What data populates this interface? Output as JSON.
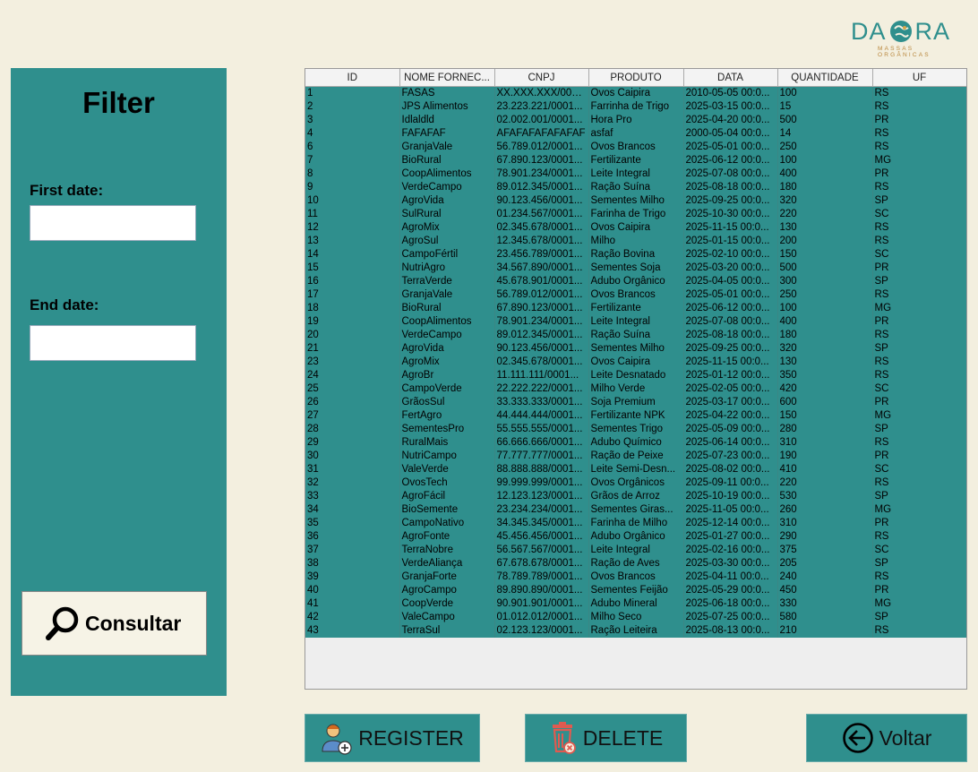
{
  "brand": {
    "logo_text_left": "DA",
    "logo_text_right": "RA",
    "logo_subtitle": "MASSAS ORGÂNICAS",
    "accent": "#2f8f8d"
  },
  "filter": {
    "title": "Filter",
    "first_date_label": "First date:",
    "first_date_value": "",
    "end_date_label": "End date:",
    "end_date_value": "",
    "consultar_label": "Consultar"
  },
  "table": {
    "columns": [
      "ID",
      "NOME FORNEC...",
      "CNPJ",
      "PRODUTO",
      "DATA",
      "QUANTIDADE",
      "UF"
    ],
    "rows": [
      [
        "1",
        "FASAS",
        "XX.XXX.XXX/0001...",
        "Ovos Caipira",
        "2010-05-05 00:0...",
        "100",
        "RS"
      ],
      [
        "2",
        "JPS Alimentos",
        "23.223.221/0001...",
        "Farrinha de Trigo",
        "2025-03-15 00:0...",
        "15",
        "RS"
      ],
      [
        "3",
        "Idlaldld",
        "02.002.001/0001...",
        "Hora Pro",
        "2025-04-20 00:0...",
        "500",
        "PR"
      ],
      [
        "4",
        "FAFAFAF",
        "AFAFAFAFAFAFAF",
        "asfaf",
        "2000-05-04 00:0...",
        "14",
        "RS"
      ],
      [
        "6",
        "GranjaVale",
        "56.789.012/0001...",
        "Ovos Brancos",
        "2025-05-01 00:0...",
        "250",
        "RS"
      ],
      [
        "7",
        "BioRural",
        "67.890.123/0001...",
        "Fertilizante",
        "2025-06-12 00:0...",
        "100",
        "MG"
      ],
      [
        "8",
        "CoopAlimentos",
        "78.901.234/0001...",
        "Leite Integral",
        "2025-07-08 00:0...",
        "400",
        "PR"
      ],
      [
        "9",
        "VerdeCampo",
        "89.012.345/0001...",
        "Ração Suína",
        "2025-08-18 00:0...",
        "180",
        "RS"
      ],
      [
        "10",
        "AgroVida",
        "90.123.456/0001...",
        "Sementes Milho",
        "2025-09-25 00:0...",
        "320",
        "SP"
      ],
      [
        "11",
        "SulRural",
        "01.234.567/0001...",
        "Farinha de Trigo",
        "2025-10-30 00:0...",
        "220",
        "SC"
      ],
      [
        "12",
        "AgroMix",
        "02.345.678/0001...",
        "Ovos Caipira",
        "2025-11-15 00:0...",
        "130",
        "RS"
      ],
      [
        "13",
        "AgroSul",
        "12.345.678/0001...",
        "Milho",
        "2025-01-15 00:0...",
        "200",
        "RS"
      ],
      [
        "14",
        "CampoFértil",
        "23.456.789/0001...",
        "Ração Bovina",
        "2025-02-10 00:0...",
        "150",
        "SC"
      ],
      [
        "15",
        "NutriAgro",
        "34.567.890/0001...",
        "Sementes Soja",
        "2025-03-20 00:0...",
        "500",
        "PR"
      ],
      [
        "16",
        "TerraVerde",
        "45.678.901/0001...",
        "Adubo Orgânico",
        "2025-04-05 00:0...",
        "300",
        "SP"
      ],
      [
        "17",
        "GranjaVale",
        "56.789.012/0001...",
        "Ovos Brancos",
        "2025-05-01 00:0...",
        "250",
        "RS"
      ],
      [
        "18",
        "BioRural",
        "67.890.123/0001...",
        "Fertilizante",
        "2025-06-12 00:0...",
        "100",
        "MG"
      ],
      [
        "19",
        "CoopAlimentos",
        "78.901.234/0001...",
        "Leite Integral",
        "2025-07-08 00:0...",
        "400",
        "PR"
      ],
      [
        "20",
        "VerdeCampo",
        "89.012.345/0001...",
        "Ração Suína",
        "2025-08-18 00:0...",
        "180",
        "RS"
      ],
      [
        "21",
        "AgroVida",
        "90.123.456/0001...",
        "Sementes Milho",
        "2025-09-25 00:0...",
        "320",
        "SP"
      ],
      [
        "23",
        "AgroMix",
        "02.345.678/0001...",
        "Ovos Caipira",
        "2025-11-15 00:0...",
        "130",
        "RS"
      ],
      [
        "24",
        "AgroBr",
        "11.111.111/0001...",
        "Leite Desnatado",
        "2025-01-12 00:0...",
        "350",
        "RS"
      ],
      [
        "25",
        "CampoVerde",
        "22.222.222/0001...",
        "Milho Verde",
        "2025-02-05 00:0...",
        "420",
        "SC"
      ],
      [
        "26",
        "GrãosSul",
        "33.333.333/0001...",
        "Soja Premium",
        "2025-03-17 00:0...",
        "600",
        "PR"
      ],
      [
        "27",
        "FertAgro",
        "44.444.444/0001...",
        "Fertilizante NPK",
        "2025-04-22 00:0...",
        "150",
        "MG"
      ],
      [
        "28",
        "SementesPro",
        "55.555.555/0001...",
        "Sementes Trigo",
        "2025-05-09 00:0...",
        "280",
        "SP"
      ],
      [
        "29",
        "RuralMais",
        "66.666.666/0001...",
        "Adubo Químico",
        "2025-06-14 00:0...",
        "310",
        "RS"
      ],
      [
        "30",
        "NutriCampo",
        "77.777.777/0001...",
        "Ração de Peixe",
        "2025-07-23 00:0...",
        "190",
        "PR"
      ],
      [
        "31",
        "ValeVerde",
        "88.888.888/0001...",
        "Leite Semi-Desn...",
        "2025-08-02 00:0...",
        "410",
        "SC"
      ],
      [
        "32",
        "OvosTech",
        "99.999.999/0001...",
        "Ovos Orgânicos",
        "2025-09-11 00:0...",
        "220",
        "RS"
      ],
      [
        "33",
        "AgroFácil",
        "12.123.123/0001...",
        "Grãos de Arroz",
        "2025-10-19 00:0...",
        "530",
        "SP"
      ],
      [
        "34",
        "BioSemente",
        "23.234.234/0001...",
        "Sementes Giras...",
        "2025-11-05 00:0...",
        "260",
        "MG"
      ],
      [
        "35",
        "CampoNativo",
        "34.345.345/0001...",
        "Farinha de Milho",
        "2025-12-14 00:0...",
        "310",
        "PR"
      ],
      [
        "36",
        "AgroFonte",
        "45.456.456/0001...",
        "Adubo Orgânico",
        "2025-01-27 00:0...",
        "290",
        "RS"
      ],
      [
        "37",
        "TerraNobre",
        "56.567.567/0001...",
        "Leite Integral",
        "2025-02-16 00:0...",
        "375",
        "SC"
      ],
      [
        "38",
        "VerdeAliança",
        "67.678.678/0001...",
        "Ração de Aves",
        "2025-03-30 00:0...",
        "205",
        "SP"
      ],
      [
        "39",
        "GranjaForte",
        "78.789.789/0001...",
        "Ovos Brancos",
        "2025-04-11 00:0...",
        "240",
        "RS"
      ],
      [
        "40",
        "AgroCampo",
        "89.890.890/0001...",
        "Sementes Feijão",
        "2025-05-29 00:0...",
        "450",
        "PR"
      ],
      [
        "41",
        "CoopVerde",
        "90.901.901/0001...",
        "Adubo Mineral",
        "2025-06-18 00:0...",
        "330",
        "MG"
      ],
      [
        "42",
        "ValeCampo",
        "01.012.012/0001...",
        "Milho Seco",
        "2025-07-25 00:0...",
        "580",
        "SP"
      ],
      [
        "43",
        "TerraSul",
        "02.123.123/0001...",
        "Ração Leiteira",
        "2025-08-13 00:0...",
        "210",
        "RS"
      ]
    ]
  },
  "actions": {
    "register_label": "REGISTER",
    "delete_label": "DELETE",
    "voltar_label": "Voltar"
  }
}
